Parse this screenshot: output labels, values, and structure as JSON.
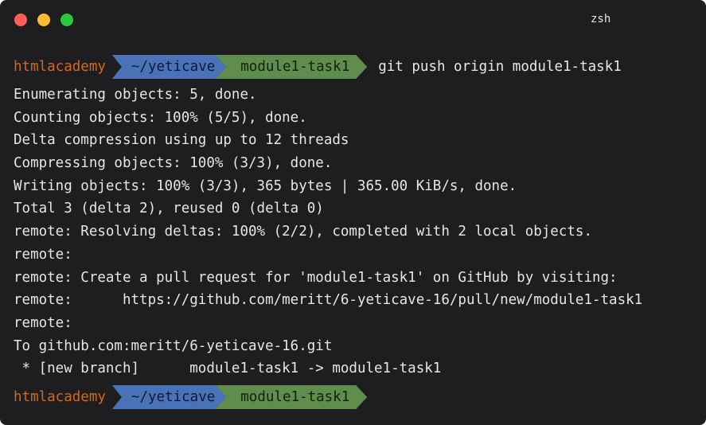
{
  "window": {
    "title": "zsh"
  },
  "prompt": {
    "user": "htmlacademy",
    "dir": "~/yeticave",
    "branch": "module1-task1"
  },
  "command": "git push origin module1-task1",
  "output": [
    "Enumerating objects: 5, done.",
    "Counting objects: 100% (5/5), done.",
    "Delta compression using up to 12 threads",
    "Compressing objects: 100% (3/3), done.",
    "Writing objects: 100% (3/3), 365 bytes | 365.00 KiB/s, done.",
    "Total 3 (delta 2), reused 0 (delta 0)",
    "remote: Resolving deltas: 100% (2/2), completed with 2 local objects.",
    "remote:",
    "remote: Create a pull request for 'module1-task1' on GitHub by visiting:",
    "remote:      https://github.com/meritt/6-yeticave-16/pull/new/module1-task1",
    "remote:",
    "To github.com:meritt/6-yeticave-16.git",
    " * [new branch]      module1-task1 -> module1-task1"
  ],
  "colors": {
    "background": "#1e1e21",
    "user": "#d2691e",
    "dir_segment": "#4a72b8",
    "branch_segment": "#5f8d4e"
  }
}
